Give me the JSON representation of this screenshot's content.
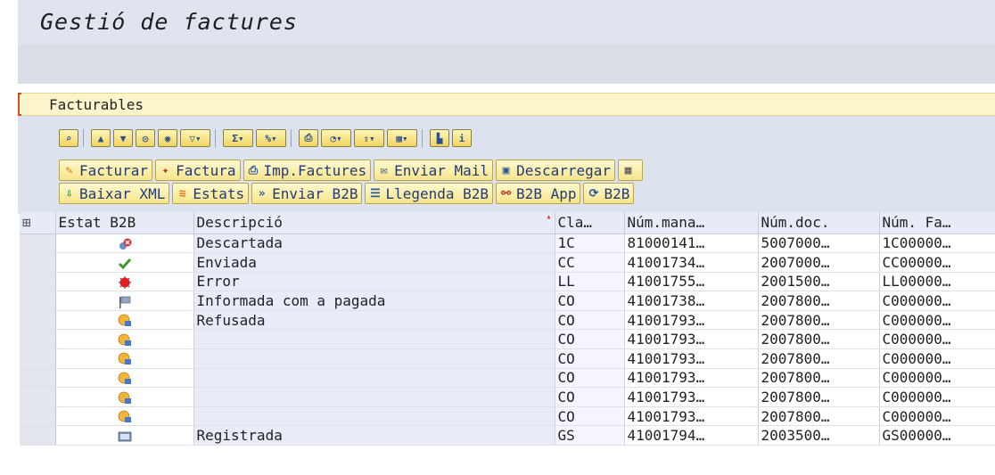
{
  "window": {
    "title": "Gestió de factures"
  },
  "section": {
    "title": "Facturables"
  },
  "function_buttons": {
    "row1": [
      "Facturar",
      "Factura",
      "Imp.Factures",
      "Enviar Mail",
      "Descarregar"
    ],
    "row2": [
      "Baixar XML",
      "Estats",
      "Enviar B2B",
      "Llegenda B2B",
      "B2B App",
      "B2B"
    ]
  },
  "table": {
    "columns": [
      "Estat B2B",
      "Descripció",
      "Cla…",
      "Núm.mana…",
      "Núm.doc.",
      "Núm. Fa…"
    ],
    "rows": [
      {
        "status_icon": "discarded-icon",
        "descripcio": "Descartada",
        "cla": "1C",
        "num_mana": "81000141…",
        "num_doc": "5007000…",
        "num_fa": "1C00000…"
      },
      {
        "status_icon": "checkmark-icon",
        "descripcio": "Enviada",
        "cla": "CC",
        "num_mana": "41001734…",
        "num_doc": "2007000…",
        "num_fa": "CC00000…"
      },
      {
        "status_icon": "error-icon",
        "descripcio": "Error",
        "cla": "LL",
        "num_mana": "41001755…",
        "num_doc": "2001500…",
        "num_fa": "LL00000…"
      },
      {
        "status_icon": "paid-flag-icon",
        "descripcio": "Informada com a pagada",
        "cla": "CO",
        "num_mana": "41001738…",
        "num_doc": "2007800…",
        "num_fa": "C000000…"
      },
      {
        "status_icon": "refused-icon",
        "descripcio": "Refusada",
        "cla": "CO",
        "num_mana": "41001793…",
        "num_doc": "2007800…",
        "num_fa": "C000000…"
      },
      {
        "status_icon": "refused-icon",
        "descripcio": "",
        "cla": "CO",
        "num_mana": "41001793…",
        "num_doc": "2007800…",
        "num_fa": "C000000…"
      },
      {
        "status_icon": "refused-icon",
        "descripcio": "",
        "cla": "CO",
        "num_mana": "41001793…",
        "num_doc": "2007800…",
        "num_fa": "C000000…"
      },
      {
        "status_icon": "refused-icon",
        "descripcio": "",
        "cla": "CO",
        "num_mana": "41001793…",
        "num_doc": "2007800…",
        "num_fa": "C000000…"
      },
      {
        "status_icon": "refused-icon",
        "descripcio": "",
        "cla": "CO",
        "num_mana": "41001793…",
        "num_doc": "2007800…",
        "num_fa": "C000000…"
      },
      {
        "status_icon": "refused-icon",
        "descripcio": "",
        "cla": "CO",
        "num_mana": "41001793…",
        "num_doc": "2007800…",
        "num_fa": "C000000…"
      },
      {
        "status_icon": "registered-icon",
        "descripcio": "Registrada",
        "cla": "GS",
        "num_mana": "41001794…",
        "num_doc": "2003500…",
        "num_fa": "GS00000…"
      }
    ]
  }
}
